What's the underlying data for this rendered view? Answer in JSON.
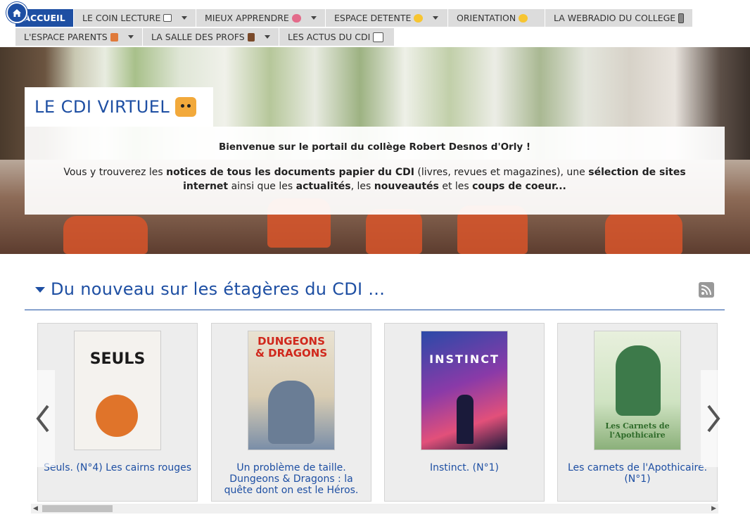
{
  "nav": {
    "row1": [
      {
        "label": "ACCUEIL",
        "active": true,
        "dropdown": false,
        "emoji": ""
      },
      {
        "label": "LE COIN LECTURE",
        "active": false,
        "dropdown": true,
        "emoji": "book-icon"
      },
      {
        "label": "MIEUX APPRENDRE",
        "active": false,
        "dropdown": true,
        "emoji": "brain-icon"
      },
      {
        "label": "ESPACE DETENTE",
        "active": false,
        "dropdown": true,
        "emoji": "smile-icon"
      },
      {
        "label": "ORIENTATION",
        "active": false,
        "dropdown": false,
        "emoji": "thinking-icon"
      },
      {
        "label": "LA WEBRADIO DU COLLEGE",
        "active": false,
        "dropdown": false,
        "emoji": "radio-icon"
      }
    ],
    "row2": [
      {
        "label": "L'ESPACE PARENTS",
        "active": false,
        "dropdown": true,
        "emoji": "house-icon"
      },
      {
        "label": "LA SALLE DES PROFS",
        "active": false,
        "dropdown": true,
        "emoji": "briefcase-icon"
      },
      {
        "label": "LES ACTUS DU CDI",
        "active": false,
        "dropdown": false,
        "emoji": "newspaper-icon"
      }
    ]
  },
  "hero": {
    "title": "LE CDI VIRTUEL",
    "welcome": "Bienvenue sur le portail du collège Robert Desnos d'Orly !",
    "p1": "Vous y trouverez les ",
    "b1": "notices de tous les documents papier du CDI",
    "p2": " (livres, revues et magazines), une ",
    "b2": "sélection de sites internet",
    "p3": " ainsi que les ",
    "b3": "actualités",
    "p4": ", les ",
    "b4": "nouveautés",
    "p5": " et les ",
    "b5": "coups de coeur..."
  },
  "section": {
    "title": "Du nouveau sur les étagères du CDI ..."
  },
  "books": [
    {
      "title": "Seuls. (N°4) Les cairns rouges",
      "cover_text": "SEULS",
      "cover_color": "#f4f2ee",
      "cover_text_color": "#1a1a1a"
    },
    {
      "title": "Un problème de taille. Dungeons & Dragons : la quête dont on est le Héros.",
      "cover_text": "DUNGEONS & DRAGONS",
      "cover_color": "#e9e2d2",
      "cover_text_color": "#d0281c"
    },
    {
      "title": "Instinct. (N°1)",
      "cover_text": "INSTINCT",
      "cover_color": "#3a2a6b",
      "cover_text_color": "#ffffff"
    },
    {
      "title": "Les carnets de l'Apothicaire. (N°1)",
      "cover_text": "Les Carnets de l'Apothicaire",
      "cover_color": "#cfe3c2",
      "cover_text_color": "#2f6b2a"
    }
  ],
  "colors": {
    "brand": "#1e4fa3",
    "nav_bg": "#dcdcdc"
  }
}
